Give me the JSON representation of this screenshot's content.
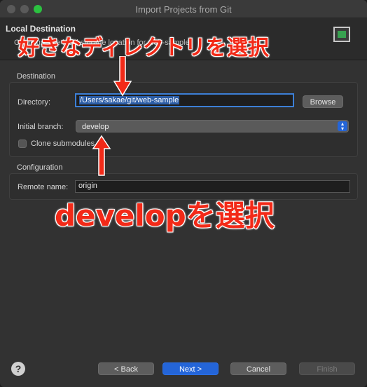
{
  "window": {
    "title": "Import Projects from Git"
  },
  "header": {
    "title": "Local Destination",
    "description": "Configure the local storage location for web-sample."
  },
  "annotations": {
    "top_text": "好きなディレクトリを選択",
    "mid_text": "developを選択"
  },
  "destination": {
    "group_label": "Destination",
    "directory_label": "Directory:",
    "directory_value": "/Users/sakae/git/web-sample",
    "browse_label": "Browse",
    "branch_label": "Initial branch:",
    "branch_value": "develop",
    "clone_submodules_label": "Clone submodules"
  },
  "configuration": {
    "group_label": "Configuration",
    "remote_label": "Remote name:",
    "remote_value": "origin"
  },
  "footer": {
    "back_label": "< Back",
    "next_label": "Next >",
    "cancel_label": "Cancel",
    "finish_label": "Finish",
    "help_glyph": "?"
  },
  "colors": {
    "accent": "#2465d8",
    "annotation": "#f22a18"
  }
}
